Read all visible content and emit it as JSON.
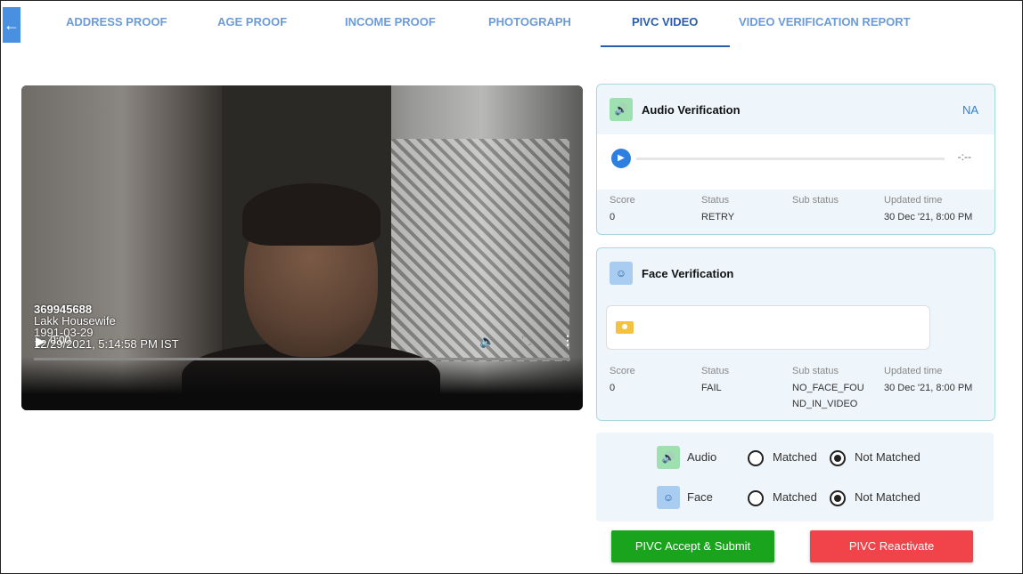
{
  "nav": {
    "back_icon": "arrow-left-icon",
    "tabs": [
      {
        "label": "ADDRESS PROOF",
        "active": false
      },
      {
        "label": "AGE PROOF",
        "active": false
      },
      {
        "label": "INCOME PROOF",
        "active": false
      },
      {
        "label": "PHOTOGRAPH",
        "active": false
      },
      {
        "label": "PIVC VIDEO",
        "active": true
      },
      {
        "label": "VIDEO VERIFICATION REPORT",
        "active": false
      }
    ]
  },
  "video": {
    "overlay_id": "369945688",
    "overlay_name": "Lakk Housewife",
    "overlay_dob": "1991-03-29",
    "overlay_timestamp": "12/29/2021, 5:14:58 PM IST",
    "current_time": "0:00"
  },
  "audio_verification": {
    "title": "Audio Verification",
    "result": "NA",
    "player_time": "-:--",
    "labels": {
      "score": "Score",
      "status": "Status",
      "sub_status": "Sub status",
      "updated": "Updated time"
    },
    "score": "0",
    "status": "RETRY",
    "sub_status": "",
    "updated_time": "30 Dec '21, 8:00 PM"
  },
  "face_verification": {
    "title": "Face Verification",
    "labels": {
      "score": "Score",
      "status": "Status",
      "sub_status": "Sub status",
      "updated": "Updated time"
    },
    "score": "0",
    "status": "FAIL",
    "sub_status_line1": "NO_FACE_FOU",
    "sub_status_line2": "ND_IN_VIDEO",
    "updated_time": "30 Dec '21, 8:00 PM"
  },
  "match": {
    "audio_label": "Audio",
    "face_label": "Face",
    "matched_label": "Matched",
    "not_matched_label": "Not Matched",
    "audio_selection": "Not Matched",
    "face_selection": "Not Matched"
  },
  "actions": {
    "accept_label": "PIVC Accept & Submit",
    "reactivate_label": "PIVC Reactivate",
    "accept_color": "#1aa31d",
    "reactivate_color": "#f0444a"
  }
}
